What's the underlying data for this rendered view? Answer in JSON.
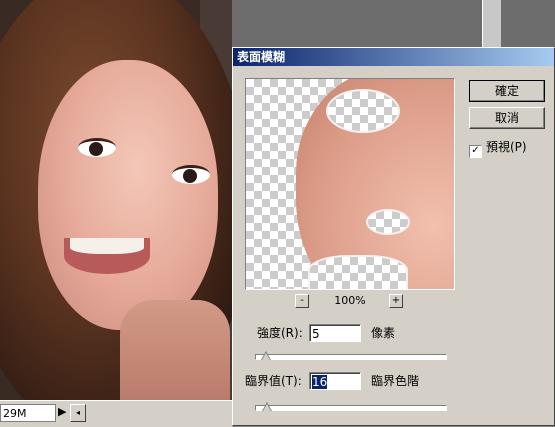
{
  "statusbar": {
    "memory_text": "29M",
    "nav_arrow": "▶"
  },
  "dialog": {
    "title": "表面模糊",
    "ok_label": "確定",
    "cancel_label": "取消",
    "preview_checkbox": {
      "label": "預視(P)",
      "checked": true,
      "check_glyph": "✓"
    },
    "zoom": {
      "minus": "-",
      "plus": "+",
      "level": "100%"
    },
    "radius": {
      "label": "強度(R):",
      "value": "5",
      "unit": "像素",
      "slider_fraction": 0.05
    },
    "threshold": {
      "label": "臨界值(T):",
      "value": "16",
      "unit": "臨界色階",
      "slider_fraction": 0.06
    }
  }
}
